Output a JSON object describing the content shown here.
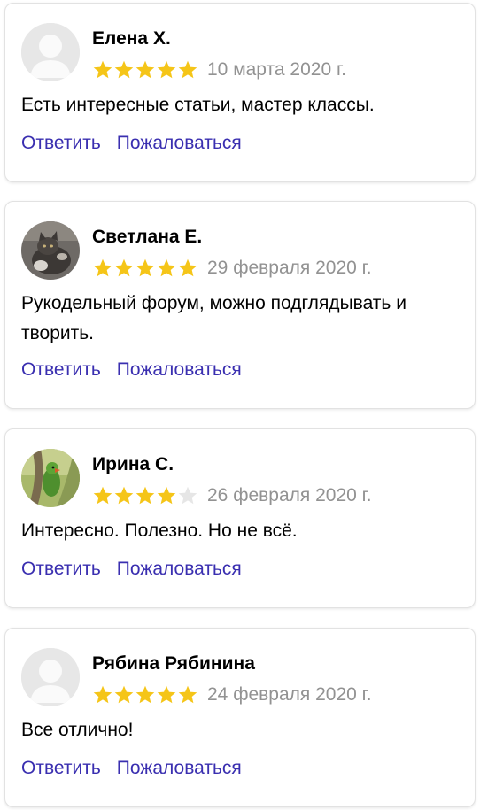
{
  "colors": {
    "star_filled": "#f5c518",
    "star_empty": "#e6e6e6",
    "link": "#3a2fb0",
    "date": "#929292"
  },
  "reviews": [
    {
      "author": "Елена Х.",
      "avatar": "placeholder-avatar",
      "rating": 5,
      "date": "10 марта 2020 г.",
      "text": "Есть интересные статьи, мастер классы.",
      "reply_label": "Ответить",
      "report_label": "Пожаловаться"
    },
    {
      "author": "Светлана Е.",
      "avatar": "cat-photo-avatar",
      "rating": 5,
      "date": "29 февраля 2020 г.",
      "text": "Рукодельный форум, можно подглядывать и творить.",
      "reply_label": "Ответить",
      "report_label": "Пожаловаться"
    },
    {
      "author": "Ирина С.",
      "avatar": "parrot-photo-avatar",
      "rating": 4,
      "date": "26 февраля 2020 г.",
      "text": "Интересно. Полезно. Но не всё.",
      "reply_label": "Ответить",
      "report_label": "Пожаловаться"
    },
    {
      "author": "Рябина Рябинина",
      "avatar": "placeholder-avatar",
      "rating": 5,
      "date": "24 февраля 2020 г.",
      "text": "Все отлично!",
      "reply_label": "Ответить",
      "report_label": "Пожаловаться"
    }
  ]
}
